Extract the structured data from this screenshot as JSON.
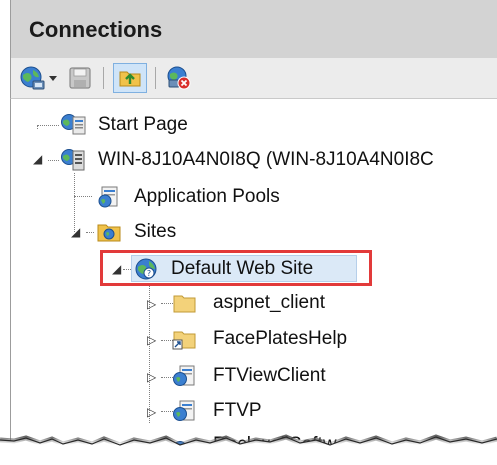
{
  "panel": {
    "title": "Connections"
  },
  "toolbar": {
    "buttons": [
      {
        "icon": "connect-globe-icon"
      },
      {
        "icon": "dropdown-arrow-icon"
      },
      {
        "icon": "save-icon"
      },
      {
        "icon": "up-folder-icon"
      },
      {
        "icon": "disconnect-icon"
      }
    ]
  },
  "tree": {
    "start_page": "Start Page",
    "server": "WIN-8J10A4N0I8Q (WIN-8J10A4N0I8C",
    "app_pools": "Application Pools",
    "sites": "Sites",
    "default_site": "Default Web Site",
    "children": [
      "aspnet_client",
      "FacePlatesHelp",
      "FTViewClient",
      "FTVP"
    ],
    "cut_off_item": "RockwellSoftw"
  },
  "colors": {
    "header_bg": "#d3d3d3",
    "highlight_border": "#e23a3a",
    "selection_bg": "#dbe9f7"
  }
}
